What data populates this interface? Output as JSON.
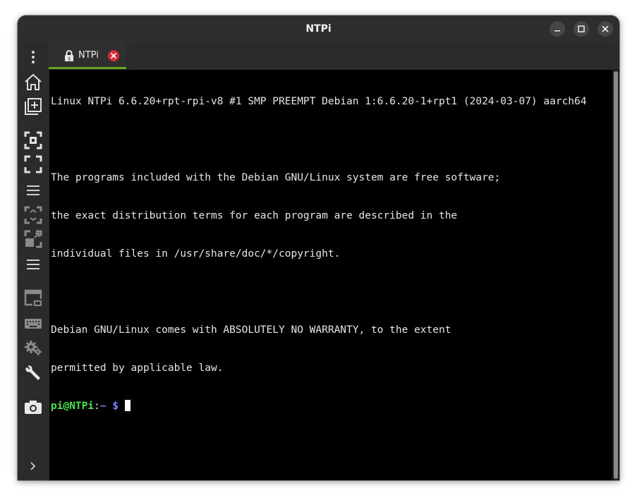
{
  "window": {
    "title": "NTPi"
  },
  "tabs": [
    {
      "label": "NTPi",
      "icon": "lock-icon",
      "active": true
    }
  ],
  "sidebar": {
    "items": [
      {
        "icon": "more-vertical-icon"
      },
      {
        "icon": "home-icon"
      },
      {
        "icon": "new-tab-icon"
      },
      {
        "icon": "fit-screen-icon"
      },
      {
        "icon": "fullscreen-icon"
      },
      {
        "icon": "menu-icon"
      },
      {
        "icon": "resize-window-icon"
      },
      {
        "icon": "scale-icon"
      },
      {
        "icon": "menu-icon"
      },
      {
        "icon": "picture-in-picture-icon"
      },
      {
        "icon": "keyboard-icon"
      },
      {
        "icon": "settings-icon"
      },
      {
        "icon": "wrench-icon"
      },
      {
        "icon": "camera-icon"
      },
      {
        "icon": "chevron-right-icon"
      }
    ]
  },
  "terminal": {
    "lines": [
      "Linux NTPi 6.6.20+rpt-rpi-v8 #1 SMP PREEMPT Debian 1:6.6.20-1+rpt1 (2024-03-07) aarch64",
      "",
      "The programs included with the Debian GNU/Linux system are free software;",
      "the exact distribution terms for each program are described in the",
      "individual files in /usr/share/doc/*/copyright.",
      "",
      "Debian GNU/Linux comes with ABSOLUTELY NO WARRANTY, to the extent",
      "permitted by applicable law."
    ],
    "prompt": {
      "user_host": "pi@NTPi",
      "separator": ":",
      "path": "~ $"
    }
  },
  "colors": {
    "prompt_user": "#4ee04e",
    "prompt_path": "#6e86ff",
    "tab_underline": "#6aa324",
    "tab_close": "#d42a3a"
  }
}
